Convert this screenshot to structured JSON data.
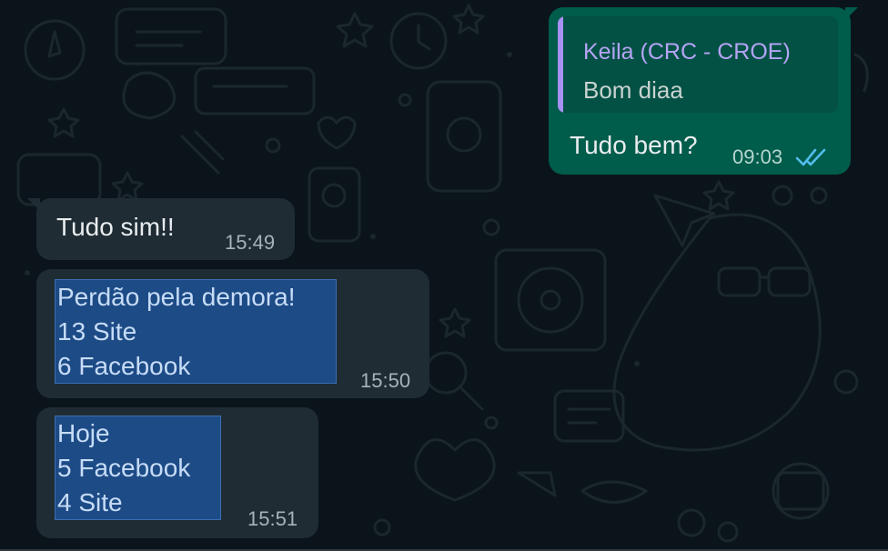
{
  "colors": {
    "background": "#0b141a",
    "outgoing_bubble": "#005c4b",
    "incoming_bubble": "#1f2c34",
    "quote_accent": "#a791f2",
    "read_ticks": "#53bdeb",
    "selection": "#1d4b86"
  },
  "outgoing": {
    "quoted": {
      "author": "Keila (CRC - CROE)",
      "text": "Bom diaa"
    },
    "text": "Tudo bem?",
    "time": "09:03",
    "status_icon": "double-check-icon"
  },
  "incoming": [
    {
      "lines": [
        "Tudo sim!!"
      ],
      "time": "15:49"
    },
    {
      "lines": [
        "Perdão pela demora!",
        "13 Site",
        "6 Facebook"
      ],
      "time": "15:50"
    },
    {
      "lines": [
        "Hoje",
        "5 Facebook",
        "4 Site"
      ],
      "time": "15:51"
    }
  ]
}
